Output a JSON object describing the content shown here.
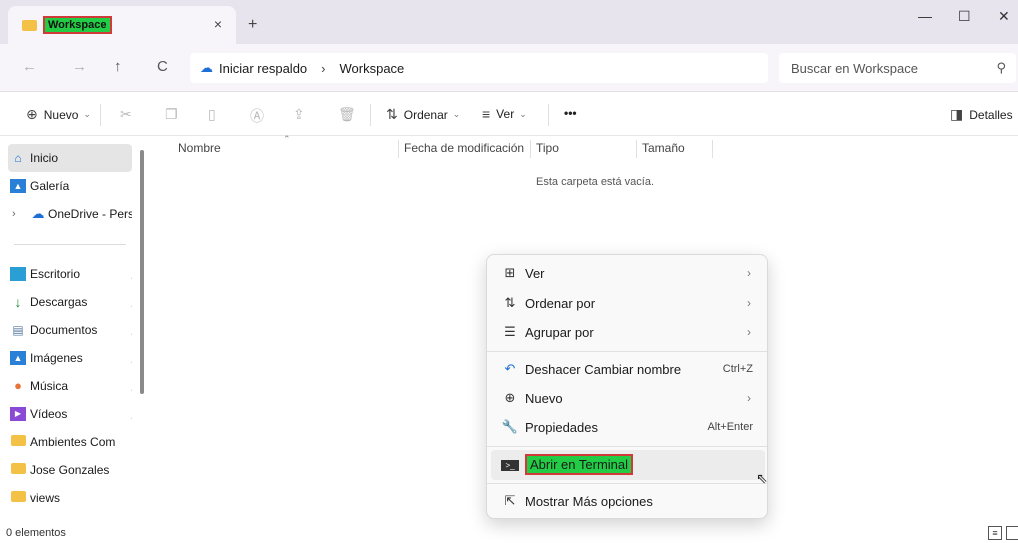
{
  "tab": {
    "title": "Workspace",
    "close": "×",
    "new": "+"
  },
  "window_controls": {
    "minimize": "—",
    "maximize": "☐",
    "close": "✕"
  },
  "address": {
    "back": "←",
    "forward": "→",
    "up": "↑",
    "refresh": "C",
    "crumbs": [
      "Iniciar respaldo",
      "Workspace"
    ],
    "separator": "›",
    "search_placeholder": "Buscar en Workspace"
  },
  "toolbar": {
    "new_label": "Nuevo",
    "sort_label": "Ordenar",
    "view_label": "Ver",
    "more": "•••",
    "details_label": "Detalles"
  },
  "sidebar": {
    "top": [
      {
        "label": "Inicio",
        "icon": "home-icon"
      },
      {
        "label": "Galería",
        "icon": "gallery-icon"
      },
      {
        "label": "OneDrive - Personal",
        "icon": "cloud-icon"
      }
    ],
    "pinned": [
      {
        "label": "Escritorio",
        "icon": "desktop-icon"
      },
      {
        "label": "Descargas",
        "icon": "download-icon"
      },
      {
        "label": "Documentos",
        "icon": "documents-icon"
      },
      {
        "label": "Imágenes",
        "icon": "pictures-icon"
      },
      {
        "label": "Música",
        "icon": "music-icon"
      },
      {
        "label": "Vídeos",
        "icon": "videos-icon"
      }
    ],
    "folders": [
      {
        "label": "Ambientes Com"
      },
      {
        "label": "Jose Gonzales"
      },
      {
        "label": "views"
      }
    ]
  },
  "columns": [
    "Nombre",
    "Fecha de modificación",
    "Tipo",
    "Tamaño"
  ],
  "empty_message": "Esta carpeta está vacía.",
  "status": {
    "count": "0 elementos"
  },
  "context_menu": {
    "items": [
      {
        "label": "Ver",
        "icon": "grid-icon",
        "submenu": true
      },
      {
        "label": "Ordenar por",
        "icon": "sort-icon",
        "submenu": true
      },
      {
        "label": "Agrupar por",
        "icon": "group-icon",
        "submenu": true
      },
      {
        "label": "Deshacer Cambiar nombre",
        "icon": "undo-icon",
        "shortcut": "Ctrl+Z"
      },
      {
        "label": "Nuevo",
        "icon": "new-icon",
        "submenu": true
      },
      {
        "label": "Propiedades",
        "icon": "properties-icon",
        "shortcut": "Alt+Enter"
      },
      {
        "label": "Abrir en Terminal",
        "icon": "terminal-icon",
        "highlighted": true
      },
      {
        "label": "Mostrar Más opciones",
        "icon": "more-options-icon"
      }
    ]
  },
  "colors": {
    "accent": "#1d6fd6",
    "highlight_fill": "#22cc44",
    "highlight_border": "#d23a3a",
    "folder": "#f2c146"
  }
}
